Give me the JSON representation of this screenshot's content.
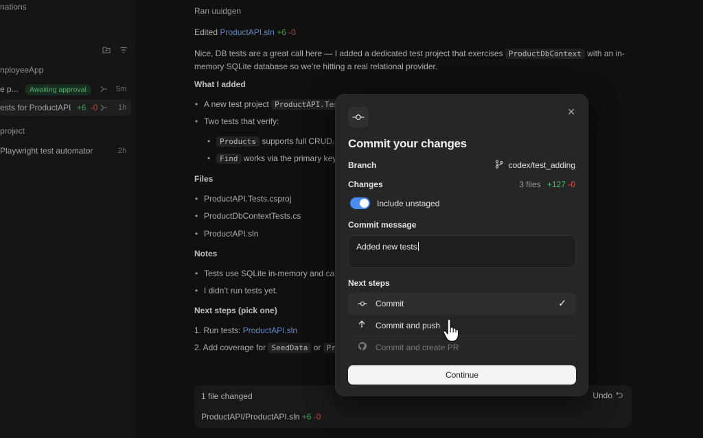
{
  "sidebar": {
    "top_label": "nations",
    "group1": "nployeeApp",
    "item1": {
      "label": "e p...",
      "badge": "Awaiting approval",
      "time": "5m"
    },
    "item2": {
      "label": "ests for ProductAPI",
      "added": "+6",
      "removed": "-0",
      "time": "1h"
    },
    "group2": "project",
    "item3": {
      "label": "Playwright test automator",
      "time": "2h"
    }
  },
  "main": {
    "author": "Ran uuidgen",
    "edited_prefix": "Edited",
    "edited_file": "ProductAPI.sln",
    "edited_added": "+6",
    "edited_removed": "-0",
    "intro_1": "Nice, DB tests are a great call here — I added a dedicated test project that exercises",
    "intro_code": "ProductDbContext",
    "intro_2": "with an in-",
    "intro_3": "memory SQLite database so we’re hitting a real relational provider.",
    "what_heading": "What I added",
    "bullet1_prefix": "A new test project",
    "bullet1_code": "ProductAPI.Tes",
    "bullet2": "Two tests that verify:",
    "sub1_code": "Products",
    "sub1_text": "supports full CRUD.",
    "sub2_code": "Find",
    "sub2_text": "works via the primary key.",
    "files_heading": "Files",
    "files": [
      "ProductAPI.Tests.csproj",
      "ProductDbContextTests.cs",
      "ProductAPI.sln"
    ],
    "notes_heading": "Notes",
    "note1": "Tests use SQLite in-memory and cal",
    "note2": "I didn’t run tests yet.",
    "next_heading": "Next steps (pick one)",
    "step1_prefix": "1. Run tests:",
    "step1_link": "ProductAPI.sln",
    "step2_prefix": "2. Add coverage for",
    "step2_code": "SeedData",
    "step2_or": "or",
    "step2_code2": "Pr"
  },
  "changes_bar": {
    "title": "1 file changed",
    "undo": "Undo",
    "file": "ProductAPI/ProductAPI.sln",
    "added": "+6",
    "removed": "-0"
  },
  "modal": {
    "title": "Commit your changes",
    "branch_label": "Branch",
    "branch_value": "codex/test_adding",
    "changes_label": "Changes",
    "files_count": "3 files",
    "added": "+127",
    "removed": "-0",
    "include_unstaged": "Include unstaged",
    "commit_message_label": "Commit message",
    "commit_message_value": "Added new tests",
    "next_steps_label": "Next steps",
    "options": [
      {
        "label": "Commit",
        "icon": "commit-icon",
        "selected": true
      },
      {
        "label": "Commit and push",
        "icon": "arrow-up-icon",
        "selected": false
      },
      {
        "label": "Commit and create PR",
        "icon": "github-icon",
        "selected": false
      }
    ],
    "continue": "Continue"
  },
  "colors": {
    "accent": "#4a8cf0",
    "added": "#4cc26a",
    "removed": "#e5534b",
    "link": "#7aa8f0"
  }
}
